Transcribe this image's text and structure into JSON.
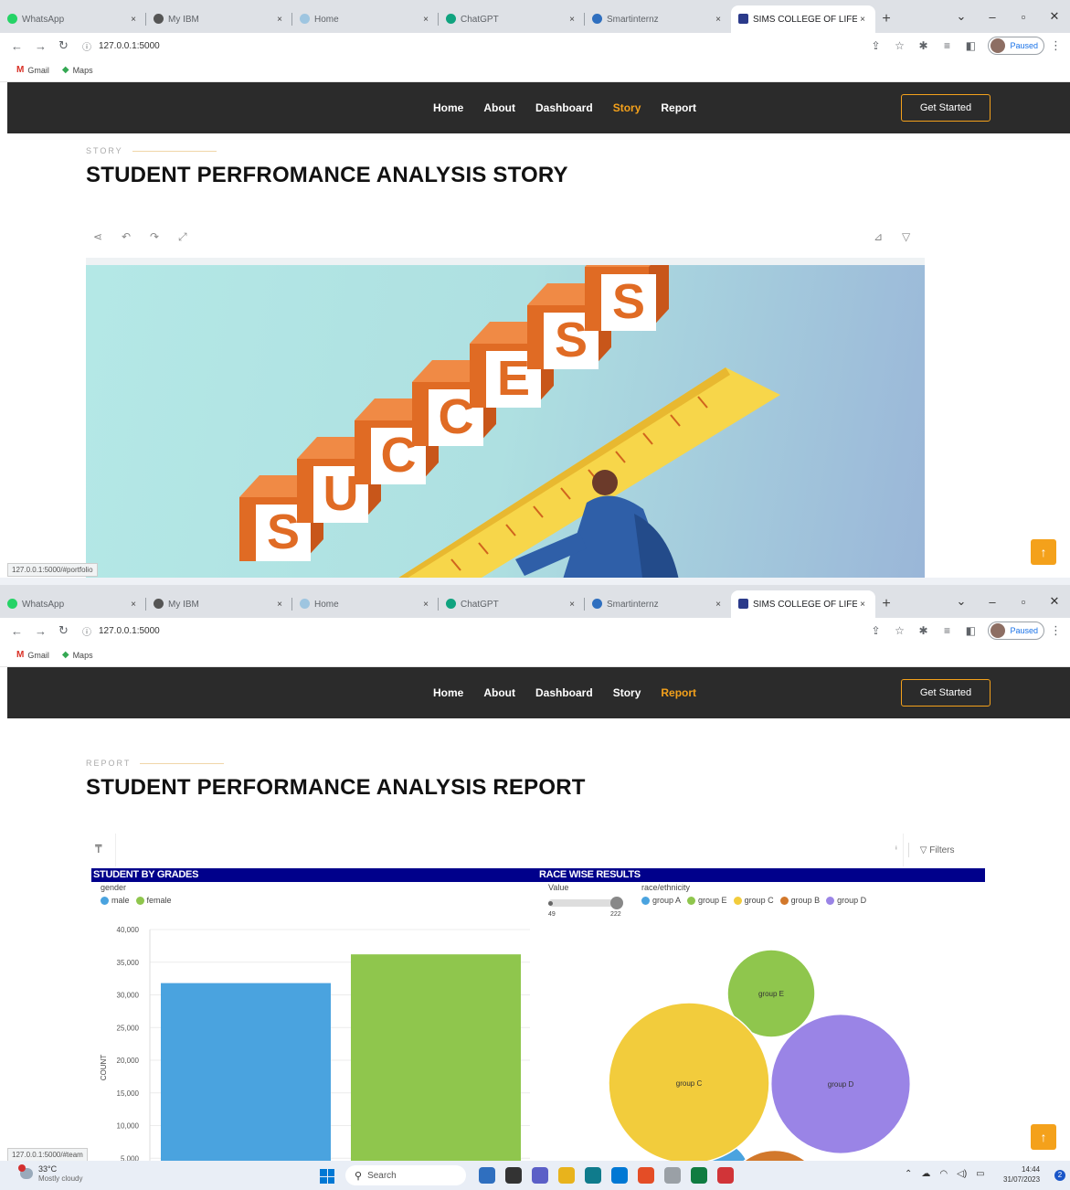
{
  "browser": {
    "tabs": [
      {
        "title": "WhatsApp",
        "color": "#25d366"
      },
      {
        "title": "My IBM",
        "color": "#555555"
      },
      {
        "title": "Home",
        "color": "#9ec5e0"
      },
      {
        "title": "ChatGPT",
        "color": "#10a37f"
      },
      {
        "title": "Smartinternz",
        "color": "#2f6fbf"
      },
      {
        "title": "SIMS COLLEGE OF LIFE SCI",
        "color": "#2b3a8a"
      }
    ],
    "new_tab_label": "+",
    "close_label": "×",
    "url": "127.0.0.1:5000",
    "profile_status": "Paused",
    "bookmarks": [
      {
        "label": "Gmail",
        "icon": "M"
      },
      {
        "label": "Maps",
        "icon": "◆"
      }
    ]
  },
  "nav": {
    "links": [
      "Home",
      "About",
      "Dashboard",
      "Story",
      "Report"
    ],
    "cta": "Get Started"
  },
  "story_page": {
    "section_label": "STORY",
    "title": "STUDENT PERFROMANCE ANALYSIS STORY",
    "illustration_text": "SUCCESS",
    "status_url": "127.0.0.1:5000/#portfolio"
  },
  "report_page": {
    "section_label": "REPORT",
    "title": "STUDENT PERFORMANCE ANALYSIS REPORT",
    "filters_label": "Filters",
    "status_url": "127.0.0.1:5000/#team"
  },
  "chart_data": [
    {
      "type": "bar",
      "title": "STUDENT BY GRADES",
      "legend_title": "gender",
      "ylabel": "COUNT",
      "categories": [
        "male",
        "female"
      ],
      "values": [
        31800,
        36200
      ],
      "colors": [
        "#4aa3df",
        "#8fc64d"
      ],
      "yticks": [
        "40,000",
        "35,000",
        "30,000",
        "25,000",
        "20,000",
        "15,000",
        "10,000",
        "5,000"
      ],
      "ylim": [
        0,
        40000
      ],
      "grid": true,
      "legend_position": "top-left"
    },
    {
      "type": "scatter",
      "title": "RACE WISE RESULTS",
      "slider_title": "Value",
      "slider_min": "49",
      "slider_max": "222",
      "legend_title": "race/ethnicity",
      "series": [
        {
          "name": "group A",
          "value": 49,
          "color": "#4aa3df"
        },
        {
          "name": "group E",
          "value": 66,
          "color": "#8fc64d"
        },
        {
          "name": "group C",
          "value": 222,
          "color": "#f2cc3c"
        },
        {
          "name": "group B",
          "value": 85,
          "color": "#d2782b"
        },
        {
          "name": "group D",
          "value": 167,
          "color": "#9a84e6"
        }
      ],
      "labelled_bubbles": [
        "group E",
        "group C",
        "group D"
      ]
    }
  ],
  "taskbar": {
    "temperature": "33°C",
    "weather": "Mostly cloudy",
    "search_placeholder": "Search",
    "time": "14:44",
    "date": "31/07/2023",
    "app_colors": [
      "#2f6fbf",
      "#333333",
      "#5b5fc7",
      "#e8b31c",
      "#0f7b8c",
      "#0078d4",
      "#e44d26",
      "#9aa0a6",
      "#107c41",
      "#d13438"
    ]
  },
  "colors": {
    "accent": "#f4a11b",
    "nav_bg": "#2b2b2b",
    "visual_header": "#00008b"
  }
}
